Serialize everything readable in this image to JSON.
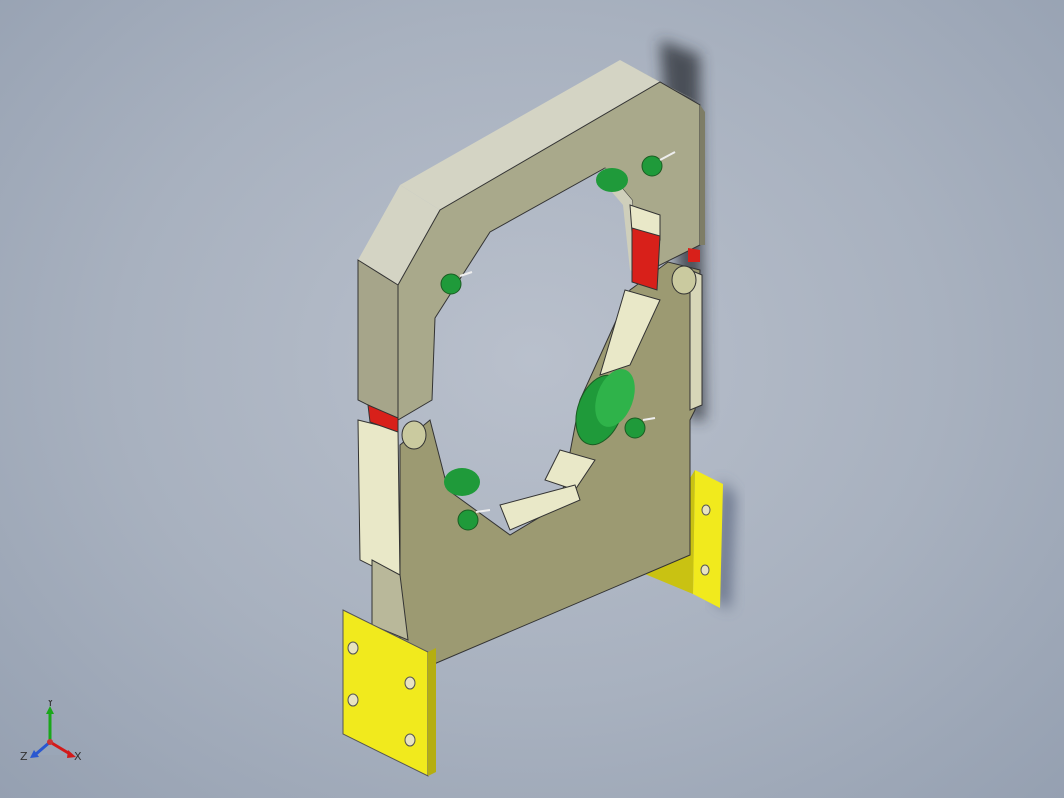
{
  "viewport": {
    "background_colors": {
      "center": "#b9c0cc",
      "mid": "#a8b1bf",
      "edge": "#95a0b1"
    }
  },
  "model": {
    "frame_color": "#a9a98b",
    "frame_top_color": "#d4d4c4",
    "panel_color": "#9c9a72",
    "panel_light_color": "#e9e8c8",
    "pad_color": "#d8201a",
    "roller_color": "#1f9a3a",
    "bracket_color": "#f1ea1d",
    "pin_color": "#caca9f"
  },
  "triad": {
    "labels": {
      "y": "Y",
      "z": "Z",
      "x": "X"
    },
    "colors": {
      "y": "#1aa71a",
      "z": "#2a57d0",
      "x": "#d21a1a"
    },
    "icon": "view-orientation-triad-icon"
  }
}
